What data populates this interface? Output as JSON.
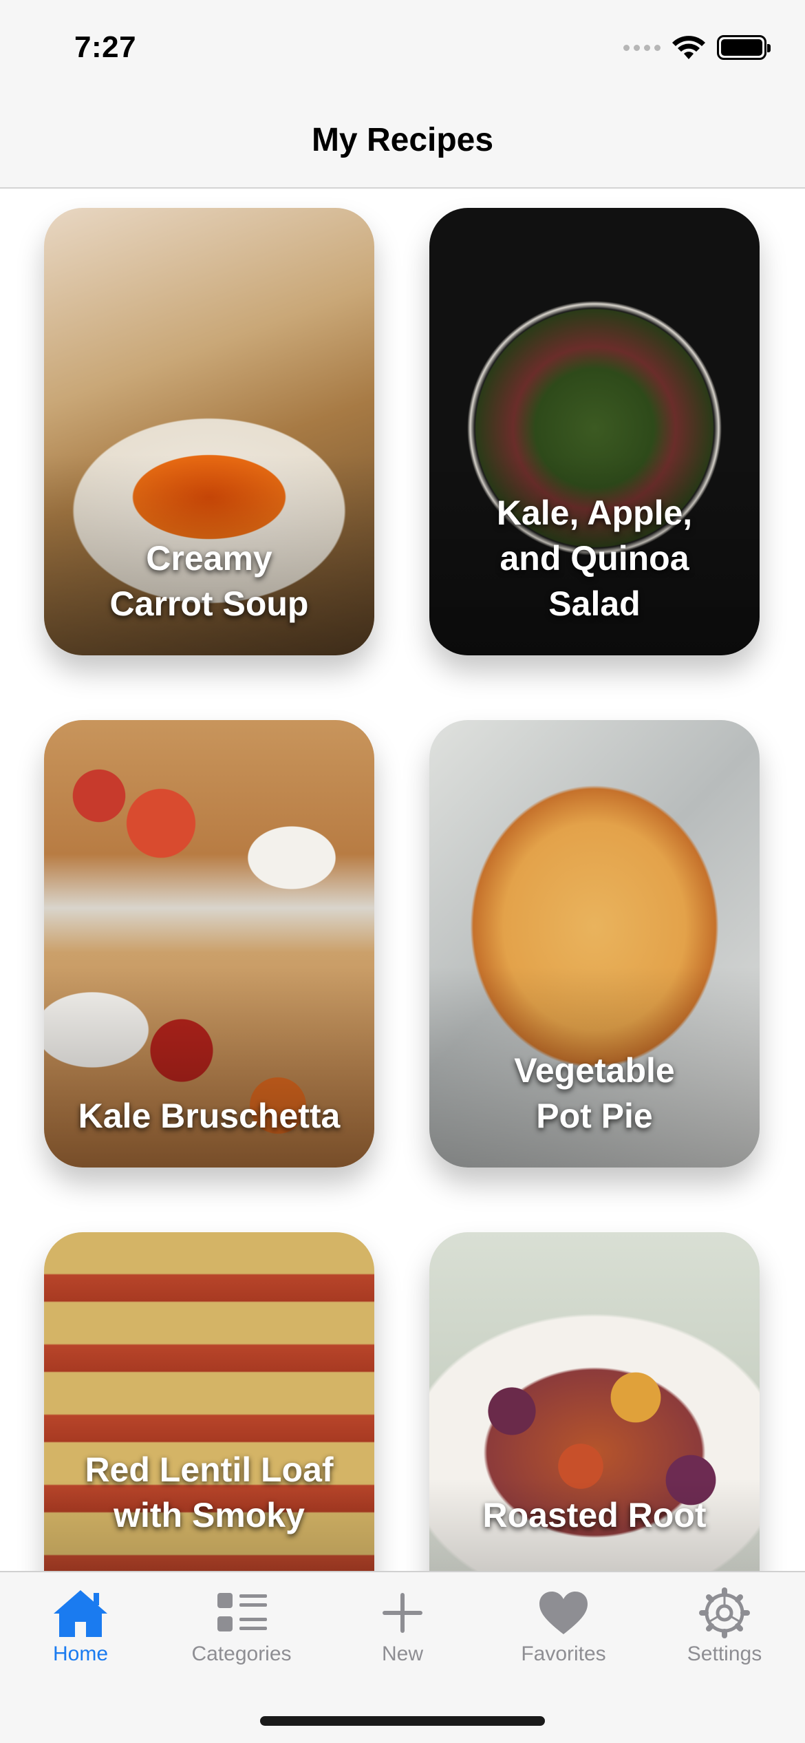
{
  "status_bar": {
    "time": "7:27"
  },
  "nav": {
    "title": "My Recipes"
  },
  "recipes": [
    {
      "title": "Creamy\nCarrot Soup"
    },
    {
      "title": "Kale, Apple,\nand Quinoa\nSalad"
    },
    {
      "title": "Kale Bruschetta"
    },
    {
      "title": "Vegetable\nPot Pie"
    },
    {
      "title": "Red Lentil Loaf\nwith Smoky"
    },
    {
      "title": "Roasted Root"
    }
  ],
  "tabs": [
    {
      "label": "Home",
      "icon": "house-icon",
      "active": true
    },
    {
      "label": "Categories",
      "icon": "list-icon",
      "active": false
    },
    {
      "label": "New",
      "icon": "plus-icon",
      "active": false
    },
    {
      "label": "Favorites",
      "icon": "heart-icon",
      "active": false
    },
    {
      "label": "Settings",
      "icon": "gear-icon",
      "active": false
    }
  ],
  "colors": {
    "accent": "#1a7bf0",
    "inactive_tab": "#8e8e93",
    "bar_background": "#f6f6f6"
  }
}
